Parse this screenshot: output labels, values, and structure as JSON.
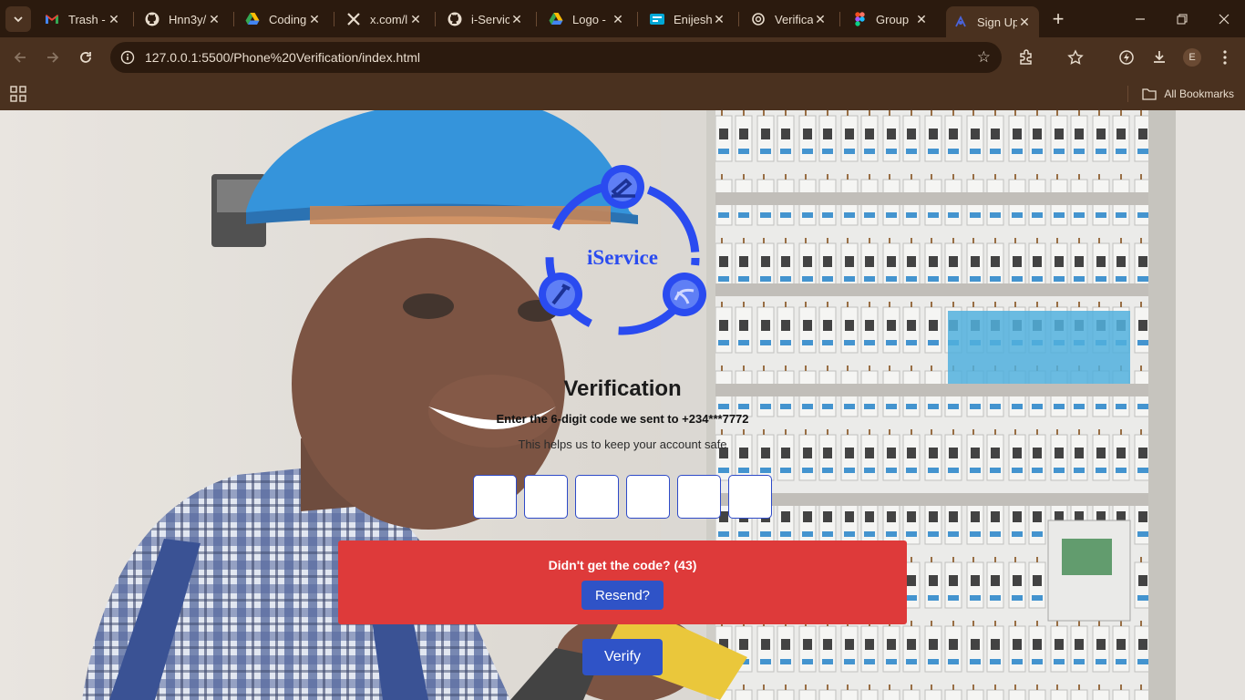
{
  "browser": {
    "tabs": [
      {
        "title": "Trash -",
        "favicon": "gmail-icon"
      },
      {
        "title": "Hnn3y/",
        "favicon": "github-icon"
      },
      {
        "title": "Coding",
        "favicon": "google-drive-icon"
      },
      {
        "title": "x.com/l",
        "favicon": "x-icon"
      },
      {
        "title": "i-Servic",
        "favicon": "github-icon"
      },
      {
        "title": "Logo -",
        "favicon": "google-drive-icon"
      },
      {
        "title": "Enijeshi",
        "favicon": "generic-site-icon"
      },
      {
        "title": "Verifica",
        "favicon": "openai-icon"
      },
      {
        "title": "Group",
        "favicon": "figma-icon"
      },
      {
        "title": "Sign Up",
        "favicon": "page-icon",
        "active": true
      }
    ],
    "url": "127.0.0.1:5500/Phone%20Verification/index.html",
    "profile_initial": "E",
    "bookmarks": {
      "all_label": "All Bookmarks"
    }
  },
  "page": {
    "logo_text": "iService",
    "title": "Verification",
    "subtitle": "Enter the 6-digit code we sent to +234***7772",
    "note": "This helps us to keep your account safe",
    "code_digits": [
      "",
      "",
      "",
      "",
      "",
      ""
    ],
    "resend": {
      "prompt": "Didn't get the code? (43)",
      "button": "Resend?"
    },
    "verify_button": "Verify"
  },
  "colors": {
    "accent": "#2f53c7",
    "panel": "#de3a3a",
    "logo_blue": "#2a4bf0"
  }
}
